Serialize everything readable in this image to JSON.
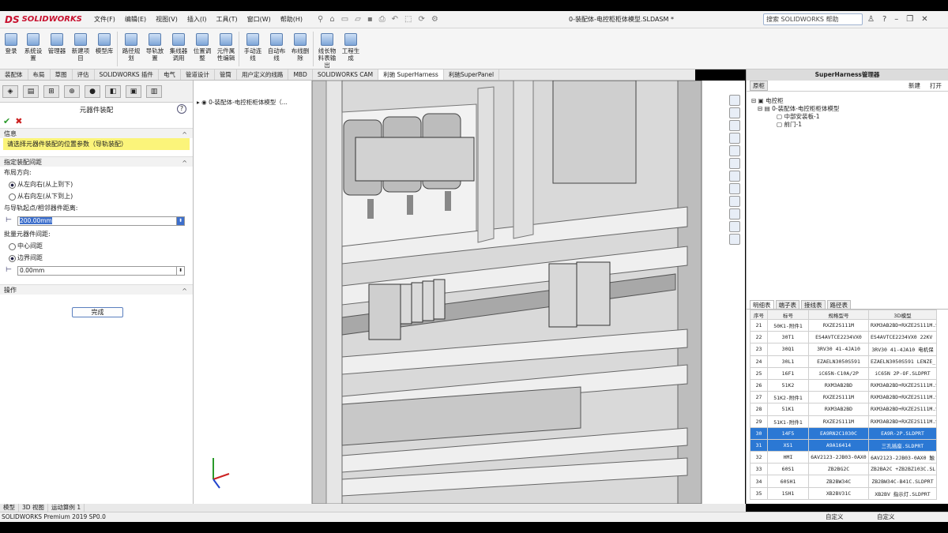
{
  "app": {
    "logo": "SOLIDWORKS",
    "logo_mark": "DS"
  },
  "menu": [
    "文件(F)",
    "编辑(E)",
    "视图(V)",
    "插入(I)",
    "工具(T)",
    "窗口(W)",
    "帮助(H)"
  ],
  "document_title": "0-装配体-电控柜柜体模型.SLDASM *",
  "search": {
    "placeholder": "搜索 SOLIDWORKS 帮助"
  },
  "ribbon": [
    {
      "label": "登录"
    },
    {
      "label": "系统设置"
    },
    {
      "label": "管理器"
    },
    {
      "label": "新建项目"
    },
    {
      "label": "模型库"
    },
    {
      "label": "路径规划"
    },
    {
      "label": "导轨放置"
    },
    {
      "label": "集线器调用"
    },
    {
      "label": "位置调整"
    },
    {
      "label": "元件属性编辑"
    },
    {
      "label": "手动连线"
    },
    {
      "label": "自动布线"
    },
    {
      "label": "布线删除"
    },
    {
      "label": "线长物料表输出"
    },
    {
      "label": "工程生成"
    }
  ],
  "tabs": [
    "装配体",
    "布局",
    "草图",
    "评估",
    "SOLIDWORKS 插件",
    "电气",
    "管道设计",
    "管筒",
    "用户定义的线路",
    "MBD",
    "SOLIDWORKS CAM",
    "利驰 SuperHarness",
    "利驰SuperPanel"
  ],
  "active_tab": "利驰 SuperHarness",
  "left_panel": {
    "title": "元器件装配",
    "info_header": "信息",
    "info_text": "请选择元器件装配的位置参数（导轨装配）",
    "spacing_header": "指定装配间距",
    "layout_direction_label": "布局方向:",
    "layout_options": [
      "从左向右(从上到下)",
      "从右向左(从下到上)"
    ],
    "layout_selected": 0,
    "start_distance_label": "与导轨起点/相邻器件距离:",
    "start_distance_value": "200.00mm",
    "batch_label": "批量元器件间距:",
    "batch_options": [
      "中心间距",
      "边界间距"
    ],
    "batch_selected": 1,
    "batch_value": "0.00mm",
    "ops_header": "操作",
    "done_label": "完成"
  },
  "feature_tree_root": "0-装配体-电控柜柜体模型（...",
  "right_panel": {
    "title": "SuperHarness管理器",
    "tab": "原柜",
    "actions": [
      "新建",
      "打开"
    ],
    "tree": [
      {
        "label": "电控柜",
        "level": 0
      },
      {
        "label": "0-装配体-电控柜柜体模型",
        "level": 1
      },
      {
        "label": "中部安装板-1",
        "level": 2
      },
      {
        "label": "前门-1",
        "level": 2
      }
    ],
    "list_tabs": [
      "明细表",
      "端子表",
      "接线表",
      "路径表"
    ],
    "columns": [
      "序号",
      "标号",
      "规格型号",
      "3D模型"
    ],
    "rows": [
      [
        "21",
        "50K1-附件1",
        "RXZE2S111M",
        "RXM3AB2BD+RXZE2S111M.S"
      ],
      [
        "22",
        "30T1",
        "ES4AVTCE2234VX0",
        "ES4AVTCE2234VX0 22KV 1"
      ],
      [
        "23",
        "30Q1",
        "3RV30 41-4JA10",
        "3RV30 41-4JA10 电机保"
      ],
      [
        "24",
        "30L1",
        "EZAELN3050S591",
        "EZAELN3050S591 LENZE_"
      ],
      [
        "25",
        "16F1",
        "iC65N-C10A/2P",
        "iC65N 2P-OF.SLDPRT"
      ],
      [
        "26",
        "51K2",
        "RXM3AB2BD",
        "RXM3AB2BD+RXZE2S111M.S"
      ],
      [
        "27",
        "51K2-附件1",
        "RXZE2S111M",
        "RXM3AB2BD+RXZE2S111M.S"
      ],
      [
        "28",
        "51K1",
        "RXM3AB2BD",
        "RXM3AB2BD+RXZE2S111M.S"
      ],
      [
        "29",
        "51K1-附件1",
        "RXZE2S111M",
        "RXM3AB2BD+RXZE2S111M.S"
      ],
      [
        "30",
        "14F5",
        "EA9RN2C1030C",
        "EA9R-2P.SLDPRT"
      ],
      [
        "31",
        "XS1",
        "A9A16414",
        "三孔插座.SLDPRT"
      ],
      [
        "32",
        "HMI",
        "6AV2123-2JB03-0AX0",
        "6AV2123-2JB03-0AX0 触"
      ],
      [
        "33",
        "60S1",
        "ZB2BG2C",
        "ZB2BA2C +ZB2BZ103C.SL"
      ],
      [
        "34",
        "60SH1",
        "ZB2BW34C",
        "ZB2BW34C-B41C.SLDPRT"
      ],
      [
        "35",
        "1SH1",
        "XB2BV31C",
        "XB2BV 指示灯.SLDPRT"
      ]
    ],
    "highlighted_rows": [
      9,
      10
    ]
  },
  "bottom_tabs": [
    "模型",
    "3D 视图",
    "运动算例 1"
  ],
  "status": {
    "version": "SOLIDWORKS Premium 2019 SP0.0",
    "custom": "自定义",
    "custom2": "自定义"
  }
}
